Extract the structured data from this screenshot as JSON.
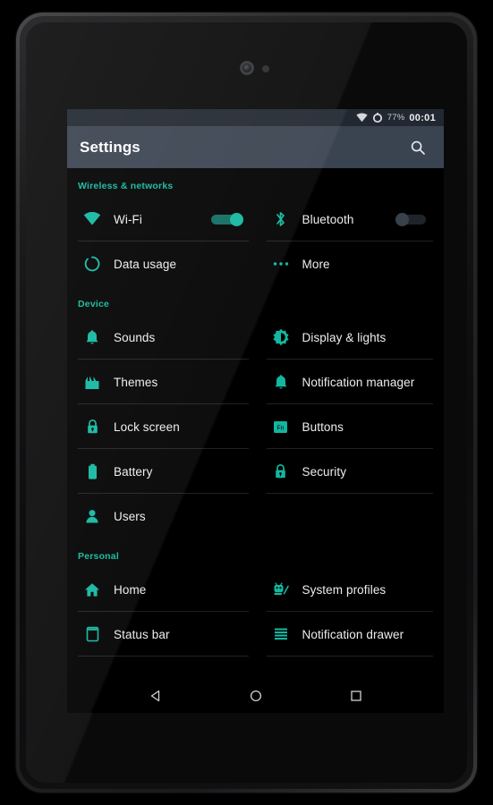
{
  "device": {
    "type": "android-tablet",
    "camera": "front-camera",
    "sensor": "proximity-sensor"
  },
  "statusbar": {
    "wifi_icon": "wifi-icon",
    "battery_icon": "battery-circle-icon",
    "battery_percent": "77%",
    "clock": "00:01"
  },
  "actionbar": {
    "title": "Settings",
    "search_icon": "search-icon"
  },
  "sections": [
    {
      "header": "Wireless & networks",
      "rows": [
        {
          "left": {
            "label": "Wi-Fi",
            "icon": "wifi-icon",
            "toggle": "on"
          },
          "right": {
            "label": "Bluetooth",
            "icon": "bluetooth-icon",
            "toggle": "off"
          }
        },
        {
          "left": {
            "label": "Data usage",
            "icon": "data-usage-icon"
          },
          "right": {
            "label": "More",
            "icon": "more-dots-icon"
          }
        }
      ]
    },
    {
      "header": "Device",
      "rows": [
        {
          "left": {
            "label": "Sounds",
            "icon": "bell-icon"
          },
          "right": {
            "label": "Display & lights",
            "icon": "brightness-icon"
          }
        },
        {
          "left": {
            "label": "Themes",
            "icon": "themes-icon"
          },
          "right": {
            "label": "Notification manager",
            "icon": "bell-icon"
          }
        },
        {
          "left": {
            "label": "Lock screen",
            "icon": "lock-icon"
          },
          "right": {
            "label": "Buttons",
            "icon": "fn-key-icon"
          }
        },
        {
          "left": {
            "label": "Battery",
            "icon": "battery-icon"
          },
          "right": {
            "label": "Security",
            "icon": "lock-icon"
          }
        },
        {
          "left": {
            "label": "Users",
            "icon": "person-icon"
          },
          "right": null
        }
      ]
    },
    {
      "header": "Personal",
      "rows": [
        {
          "left": {
            "label": "Home",
            "icon": "home-icon"
          },
          "right": {
            "label": "System profiles",
            "icon": "android-profile-icon"
          }
        },
        {
          "left": {
            "label": "Status bar",
            "icon": "status-bar-icon"
          },
          "right": {
            "label": "Notification drawer",
            "icon": "drawer-lines-icon"
          }
        }
      ]
    }
  ],
  "navbar": {
    "back": "back-triangle-icon",
    "home": "home-circle-icon",
    "recents": "recents-square-icon"
  },
  "colors": {
    "accent": "#13b7a0",
    "actionbar": "#3a4350",
    "statusbar": "#222831",
    "background": "#000000",
    "text": "#eeeeee",
    "divider": "#212121"
  }
}
